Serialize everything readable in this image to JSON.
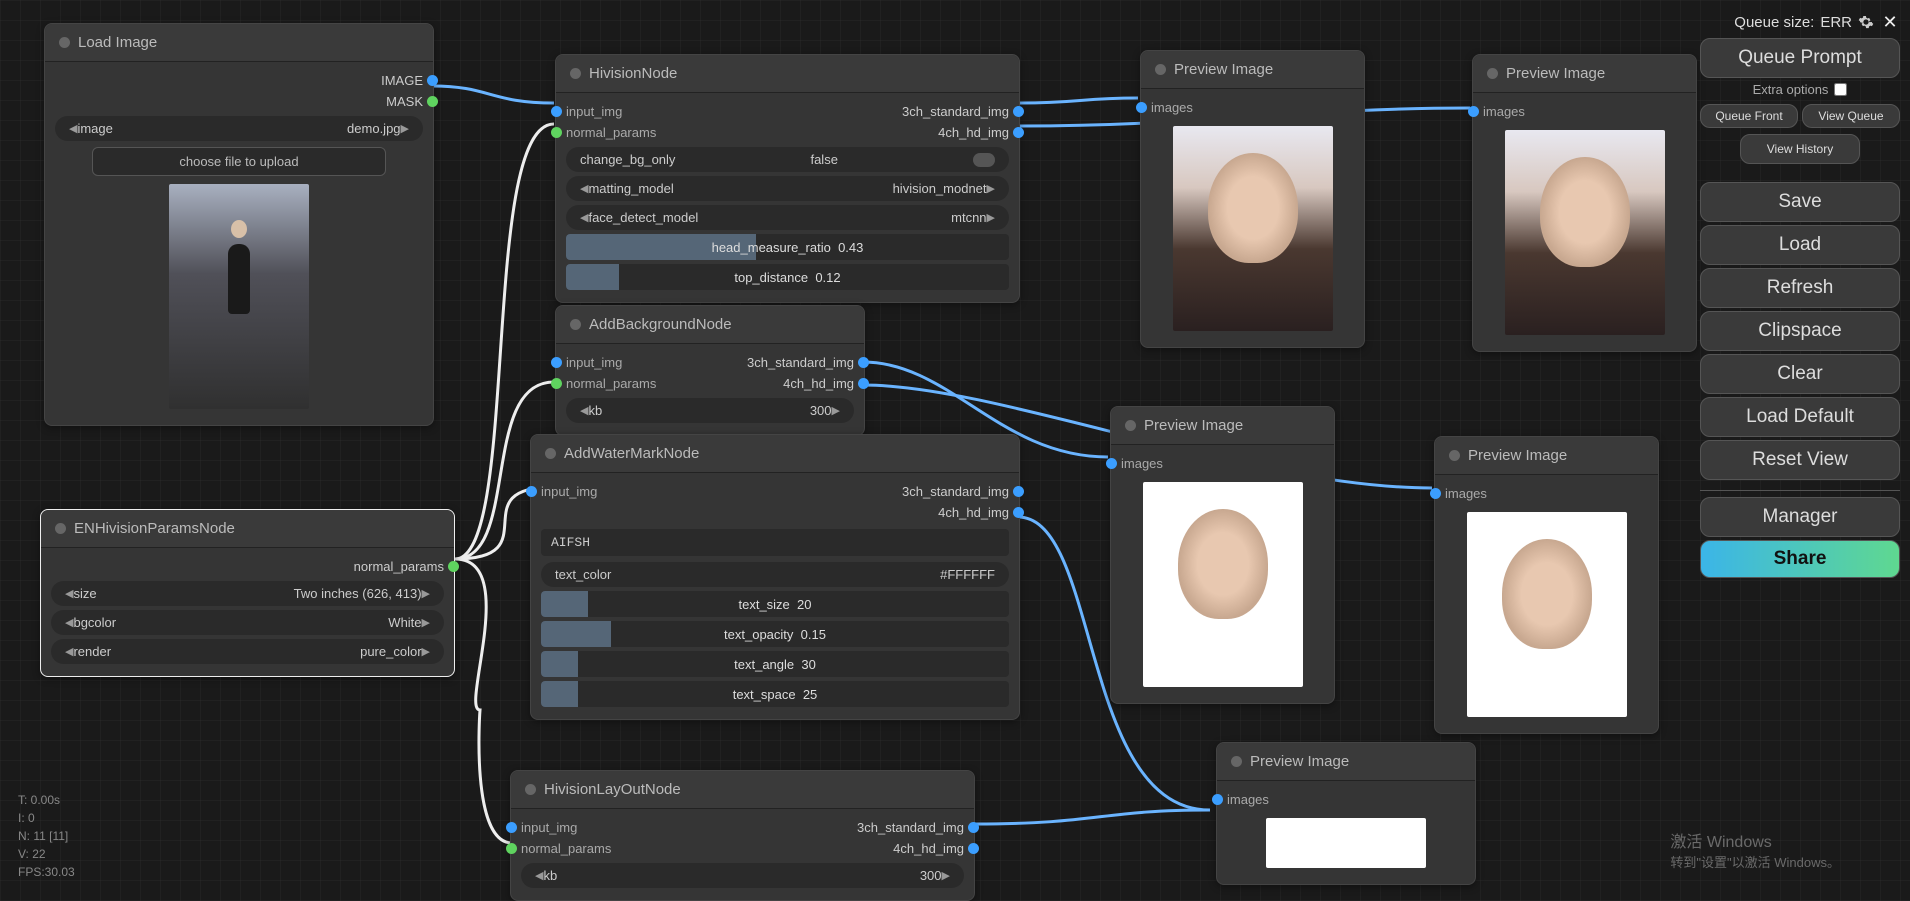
{
  "sidebar": {
    "queue_size_label": "Queue size:",
    "queue_size_value": "ERR",
    "queue_prompt": "Queue Prompt",
    "extra_options": "Extra options",
    "queue_front": "Queue Front",
    "view_queue": "View Queue",
    "view_history": "View History",
    "save": "Save",
    "load": "Load",
    "refresh": "Refresh",
    "clipspace": "Clipspace",
    "clear": "Clear",
    "load_default": "Load Default",
    "reset_view": "Reset View",
    "manager": "Manager",
    "share": "Share"
  },
  "nodes": {
    "load_image": {
      "title": "Load Image",
      "out_image": "IMAGE",
      "out_mask": "MASK",
      "image_label": "image",
      "image_value": "demo.jpg",
      "choose_file": "choose file to upload"
    },
    "en_params": {
      "title": "ENHivisionParamsNode",
      "out_normal": "normal_params",
      "size_label": "size",
      "size_value": "Two inches  (626, 413)",
      "bgcolor_label": "bgcolor",
      "bgcolor_value": "White",
      "render_label": "render",
      "render_value": "pure_color"
    },
    "hivision": {
      "title": "HivisionNode",
      "in_img": "input_img",
      "in_params": "normal_params",
      "out_3ch": "3ch_standard_img",
      "out_4ch": "4ch_hd_img",
      "change_bg_label": "change_bg_only",
      "change_bg_value": "false",
      "matting_label": "matting_model",
      "matting_value": "hivision_modnet",
      "face_label": "face_detect_model",
      "face_value": "mtcnn",
      "head_ratio_label": "head_measure_ratio",
      "head_ratio_value": "0.43",
      "top_dist_label": "top_distance",
      "top_dist_value": "0.12"
    },
    "add_bg": {
      "title": "AddBackgroundNode",
      "in_img": "input_img",
      "in_params": "normal_params",
      "out_3ch": "3ch_standard_img",
      "out_4ch": "4ch_hd_img",
      "kb_label": "kb",
      "kb_value": "300"
    },
    "watermark": {
      "title": "AddWaterMarkNode",
      "in_img": "input_img",
      "out_3ch": "3ch_standard_img",
      "out_4ch": "4ch_hd_img",
      "text_value": "AIFSH",
      "text_color_label": "text_color",
      "text_color_value": "#FFFFFF",
      "text_size_label": "text_size",
      "text_size_value": "20",
      "text_opacity_label": "text_opacity",
      "text_opacity_value": "0.15",
      "text_angle_label": "text_angle",
      "text_angle_value": "30",
      "text_space_label": "text_space",
      "text_space_value": "25"
    },
    "layout": {
      "title": "HivisionLayOutNode",
      "in_img": "input_img",
      "in_params": "normal_params",
      "out_3ch": "3ch_standard_img",
      "out_4ch": "4ch_hd_img",
      "kb_label": "kb",
      "kb_value": "300"
    },
    "preview": {
      "title": "Preview Image",
      "in_images": "images"
    }
  },
  "stats": {
    "t": "T: 0.00s",
    "i": "I: 0",
    "n": "N: 11 [11]",
    "v": "V: 22",
    "fps": "FPS:30.03"
  },
  "windows_watermark": {
    "line1": "激活 Windows",
    "line2": "转到\"设置\"以激活 Windows。"
  }
}
